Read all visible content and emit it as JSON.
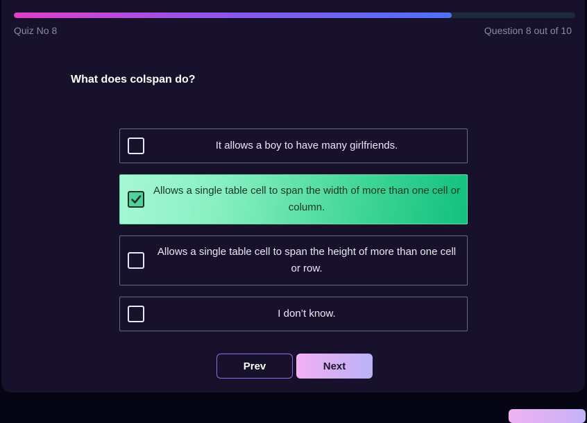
{
  "header": {
    "quiz_label": "Quiz No 8",
    "question_count": "Question 8 out of 10",
    "progress_fraction": 0.78
  },
  "question": {
    "text": "What does colspan do?"
  },
  "options": [
    {
      "text": "It allows a boy to have many girlfriends.",
      "selected": false
    },
    {
      "text": "Allows a single table cell to span the width of more than one cell or column.",
      "selected": true
    },
    {
      "text": "Allows a single table cell to span the height of more than one cell or row.",
      "selected": false
    },
    {
      "text": "I don’t know.",
      "selected": false
    }
  ],
  "nav": {
    "prev_label": "Prev",
    "next_label": "Next"
  },
  "colors": {
    "background": "#050514",
    "card": "#17112b",
    "selected_option": "#3fd597",
    "accent": "#8e6ae6"
  }
}
